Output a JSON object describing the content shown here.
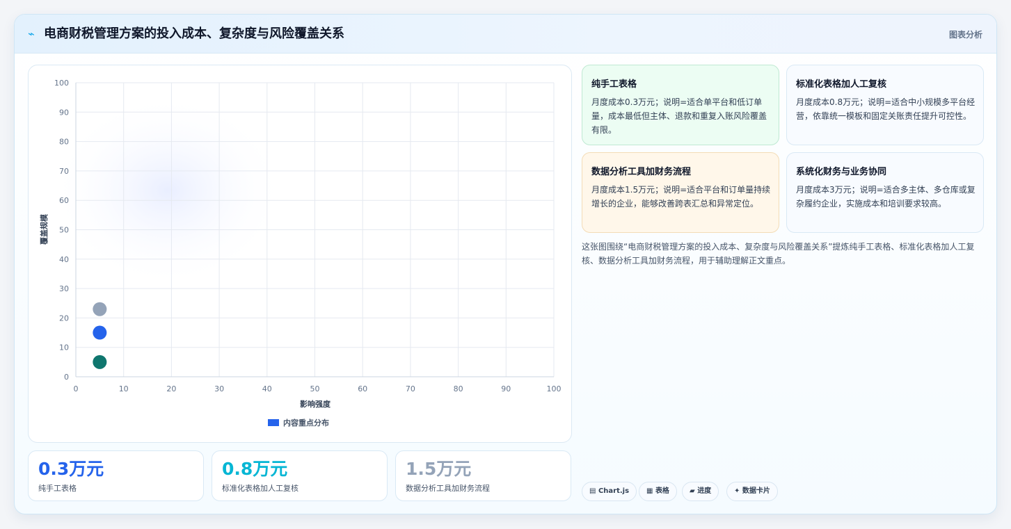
{
  "header": {
    "title": "电商财税管理方案的投入成本、复杂度与风险覆盖关系",
    "tag": "图表分析"
  },
  "chart_data": {
    "type": "scatter",
    "xlabel": "影响强度",
    "ylabel": "覆盖规模",
    "xlim": [
      0,
      100
    ],
    "ylim": [
      0,
      100
    ],
    "xticks": [
      0,
      10,
      20,
      30,
      40,
      50,
      60,
      70,
      80,
      90,
      100
    ],
    "yticks": [
      0,
      10,
      20,
      30,
      40,
      50,
      60,
      70,
      80,
      90,
      100
    ],
    "grid": true,
    "legend": {
      "position": "bottom",
      "entries": [
        "内容重点分布"
      ]
    },
    "series": [
      {
        "name": "内容重点分布",
        "color": "#2563eb",
        "points": [
          {
            "x": 5,
            "y": 5,
            "color": "#0f766e"
          },
          {
            "x": 5,
            "y": 15,
            "color": "#2563eb"
          },
          {
            "x": 5,
            "y": 23,
            "color": "#94a3b8"
          }
        ]
      }
    ]
  },
  "stats": [
    {
      "value": "0.3万元",
      "label": "纯手工表格",
      "color": "#2563eb"
    },
    {
      "value": "0.8万元",
      "label": "标准化表格加人工复核",
      "color": "#06b6d4"
    },
    {
      "value": "1.5万元",
      "label": "数据分析工具加财务流程",
      "color": "#94a3b8"
    }
  ],
  "cards": [
    {
      "title": "纯手工表格",
      "text": "月度成本0.3万元；说明=适合单平台和低订单量，成本最低但主体、退款和重复入账风险覆盖有限。"
    },
    {
      "title": "标准化表格加人工复核",
      "text": "月度成本0.8万元；说明=适合中小规模多平台经营，依靠统一模板和固定关账责任提升可控性。"
    },
    {
      "title": "数据分析工具加财务流程",
      "text": "月度成本1.5万元；说明=适合平台和订单量持续增长的企业，能够改善跨表汇总和异常定位。"
    },
    {
      "title": "系统化财务与业务协同",
      "text": "月度成本3万元；说明=适合多主体、多仓库或复杂履约企业，实施成本和培训要求较高。"
    }
  ],
  "summary": "这张图围绕“电商财税管理方案的投入成本、复杂度与风险覆盖关系”提炼纯手工表格、标准化表格加人工复核、数据分析工具加财务流程，用于辅助理解正文重点。",
  "chips": [
    {
      "icon": "▤",
      "label": "Chart.js"
    },
    {
      "icon": "▦",
      "label": "表格"
    },
    {
      "icon": "▰",
      "label": "进度"
    },
    {
      "icon": "✦",
      "label": "数据卡片"
    }
  ]
}
